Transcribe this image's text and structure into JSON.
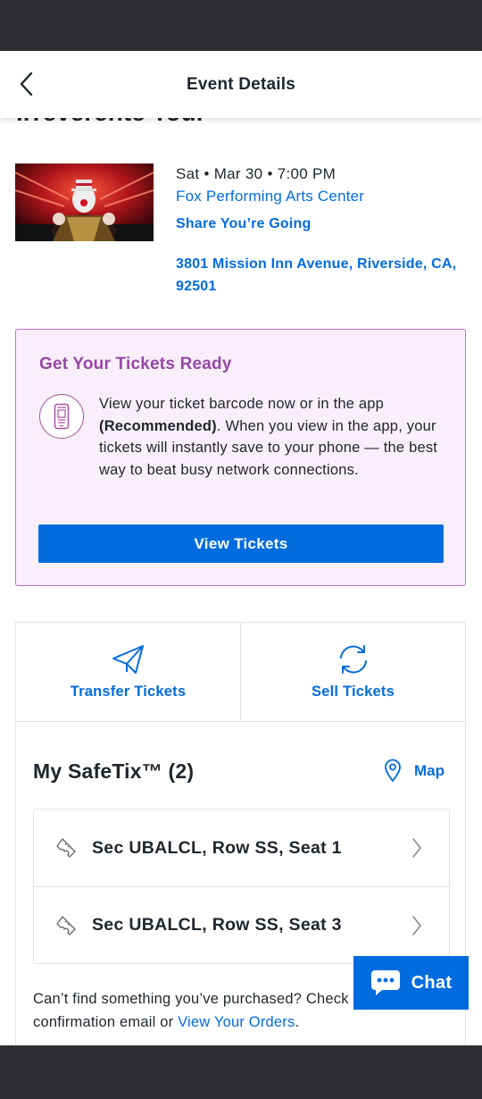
{
  "header": {
    "title": "Event Details",
    "back_icon": "chevron-left-icon"
  },
  "event": {
    "title_partial": "Irreverente Tour",
    "image_alt": "Performer in clown makeup on stage with red lights",
    "date_time": "Sat • Mar 30 • 7:00 PM",
    "venue": "Fox Performing Arts Center",
    "share_label": "Share You’re Going",
    "address": "3801 Mission Inn Avenue, Riverside, CA, 92501"
  },
  "tickets_ready": {
    "title": "Get Your Tickets Ready",
    "text_before": "View your ticket barcode now or in the app ",
    "text_bold": "(Recommended)",
    "text_after": ". When you view in the app, your tickets will instantly save to your phone — the best way to beat busy network connections.",
    "button_label": "View Tickets",
    "icon": "phone-icon"
  },
  "actions": [
    {
      "label": "Transfer Tickets",
      "icon": "paper-plane-icon"
    },
    {
      "label": "Sell Tickets",
      "icon": "refresh-icon"
    }
  ],
  "safetix": {
    "title": "My SafeTix™ (2)",
    "map_label": "Map",
    "seats": [
      {
        "label": "Sec UBALCL, Row SS, Seat 1"
      },
      {
        "label": "Sec UBALCL, Row SS, Seat 3"
      }
    ]
  },
  "help": {
    "text_before": "Can’t find something you’ve purchased? Check your order confirmation email or ",
    "link": "View Your Orders",
    "text_after": "."
  },
  "chat": {
    "label": "Chat"
  },
  "colors": {
    "accent": "#026cdf",
    "purple_title": "#9747a5",
    "card_bg": "#f8effb",
    "card_border": "#c86ad6",
    "system_bar": "#2b2d30"
  }
}
